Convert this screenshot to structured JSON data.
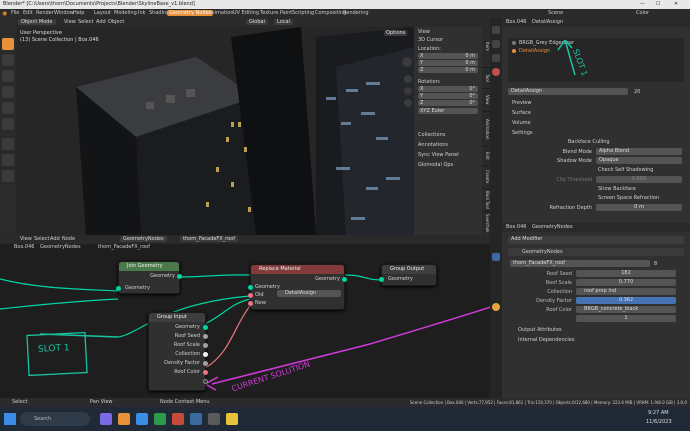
{
  "titlebar": {
    "title": "Blender* [C:\\Users\\thorn\\Documents\\Projects\\Blender\\SkylineBase_v1.blend]",
    "min": "—",
    "max": "☐",
    "close": "✕"
  },
  "menu": [
    "File",
    "Edit",
    "Render",
    "Window",
    "Help"
  ],
  "workspaces": [
    "Layout",
    "Modeling",
    "Ink",
    "Shading",
    "Geometry Nodes",
    "Animation",
    "UV Editing",
    "Texture Paint",
    "Scripting",
    "Compositing",
    "Rendering"
  ],
  "workspace_active": 4,
  "scene": {
    "label": "Scene",
    "layer": "Color"
  },
  "viewport": {
    "mode": "Object Mode",
    "menus": [
      "View",
      "Select",
      "Add",
      "Object"
    ],
    "global": "Global",
    "local": "Local",
    "overlay1": "User Perspective",
    "overlay2": "(13) Scene Collection | Box.046",
    "options": "Options",
    "n_panel": {
      "sections": [
        "View",
        "3D Cursor"
      ],
      "location_label": "Location:",
      "rotation_label": "Rotation:",
      "axes": [
        {
          "axis": "X",
          "value": "0 m"
        },
        {
          "axis": "Y",
          "value": "0 m"
        },
        {
          "axis": "Z",
          "value": "0 m"
        }
      ],
      "rot": [
        {
          "axis": "X",
          "value": "0°"
        },
        {
          "axis": "Y",
          "value": "0°"
        },
        {
          "axis": "Z",
          "value": "0°"
        }
      ],
      "euler": "XYZ Euler",
      "more": [
        "Collections",
        "Annotations",
        "Sync View Panel",
        "Glomodal Ops"
      ]
    },
    "tabs": [
      "Item",
      "Tool",
      "View",
      "Animation",
      "Edit",
      "Create",
      "Bool Tool",
      "Sverchok"
    ]
  },
  "material": {
    "breadcrumb": [
      "Box.046",
      "DetailAssign"
    ],
    "slots": [
      "BRGB_Grey Edgewear",
      "DetailAssign"
    ],
    "name": "DetailAssign",
    "users": "20",
    "sections": [
      "Preview",
      "Surface",
      "Volume",
      "Settings"
    ],
    "backface": "Backface Culling",
    "blend_label": "Blend Mode",
    "blend": "Alpha Blend",
    "shadow_label": "Shadow Mode",
    "shadow": "Opaque",
    "self_shadow": "Check Self Shadowing",
    "clip_label": "Clip Threshold",
    "clip": "0.500",
    "show_backface": "Show Backface",
    "refraction": "Screen Space Refraction",
    "depth_label": "Refraction Depth",
    "depth": "0 m"
  },
  "modifier": {
    "breadcrumb": [
      "Box.046",
      "GeometryNodes"
    ],
    "add": "Add Modifier",
    "name": "GeometryNodes",
    "group": "thorn_FacadeFX_roof",
    "count": "8",
    "props": [
      {
        "label": "Roof Seed",
        "value": "182"
      },
      {
        "label": "Roof Scale",
        "value": "0.770"
      },
      {
        "label": "Collection",
        "value": "roof prop ind"
      },
      {
        "label": "Density Factor",
        "value": "0.362"
      },
      {
        "label": "Roof Color",
        "value": "BRGB_concrete_black"
      }
    ],
    "slot_value": "1",
    "outputs": "Output Attributes",
    "deps": "Internal Dependencies"
  },
  "nodeeditor": {
    "menus": [
      "View",
      "Select",
      "Add",
      "Node"
    ],
    "group_label": "GeometryNodes",
    "tree": "thorn_FacadeFX_roof",
    "breadcrumb": [
      "Box.046",
      "GeometryNodes",
      "thorn_FacadeFX_roof"
    ],
    "join": {
      "title": "Join Geometry",
      "out": "Geometry",
      "in": "Geometry"
    },
    "replace": {
      "title": "Replace Material",
      "out": "Geometry",
      "in": [
        "Geometry",
        "Old",
        "New"
      ],
      "mat": "DetailAssign"
    },
    "output": {
      "title": "Group Output",
      "in": "Geometry"
    },
    "input": {
      "title": "Group Input",
      "outs": [
        "Geometry",
        "Roof Seed",
        "Roof Scale",
        "Collection",
        "Density Factor",
        "Roof Color"
      ]
    }
  },
  "annotations": {
    "slot_top": "SLOT 1",
    "slot_box": "SLOT 1",
    "current": "CURRENT SOLUTION"
  },
  "statusbar": {
    "select": "Select",
    "pan": "Pan View",
    "ctx": "Node Context Menu",
    "info": "Scene Collection | Box.046 | Verts:77,952 | Faces:81,861 | Tris:119,370 | Objects:0/12,680 | Memory: 223.6 MiB | VRAM: 1.9/8.0 GiB | 3.6.0 Cui Engine"
  },
  "taskbar": {
    "search": "Search",
    "weather": "",
    "time": "9:27 AM",
    "date": "11/6/2023"
  },
  "colors": {
    "accent": "#e8903a",
    "annot_green": "#19c4a0",
    "annot_magenta": "#d13adb",
    "geom_socket": "#00d6a3",
    "float_socket": "#a1a1a1",
    "mat_socket": "#eb7582",
    "node_green_hdr": "#4a7a4a",
    "node_red_hdr": "#833a3a",
    "node_gray_hdr": "#3e3e3e"
  }
}
